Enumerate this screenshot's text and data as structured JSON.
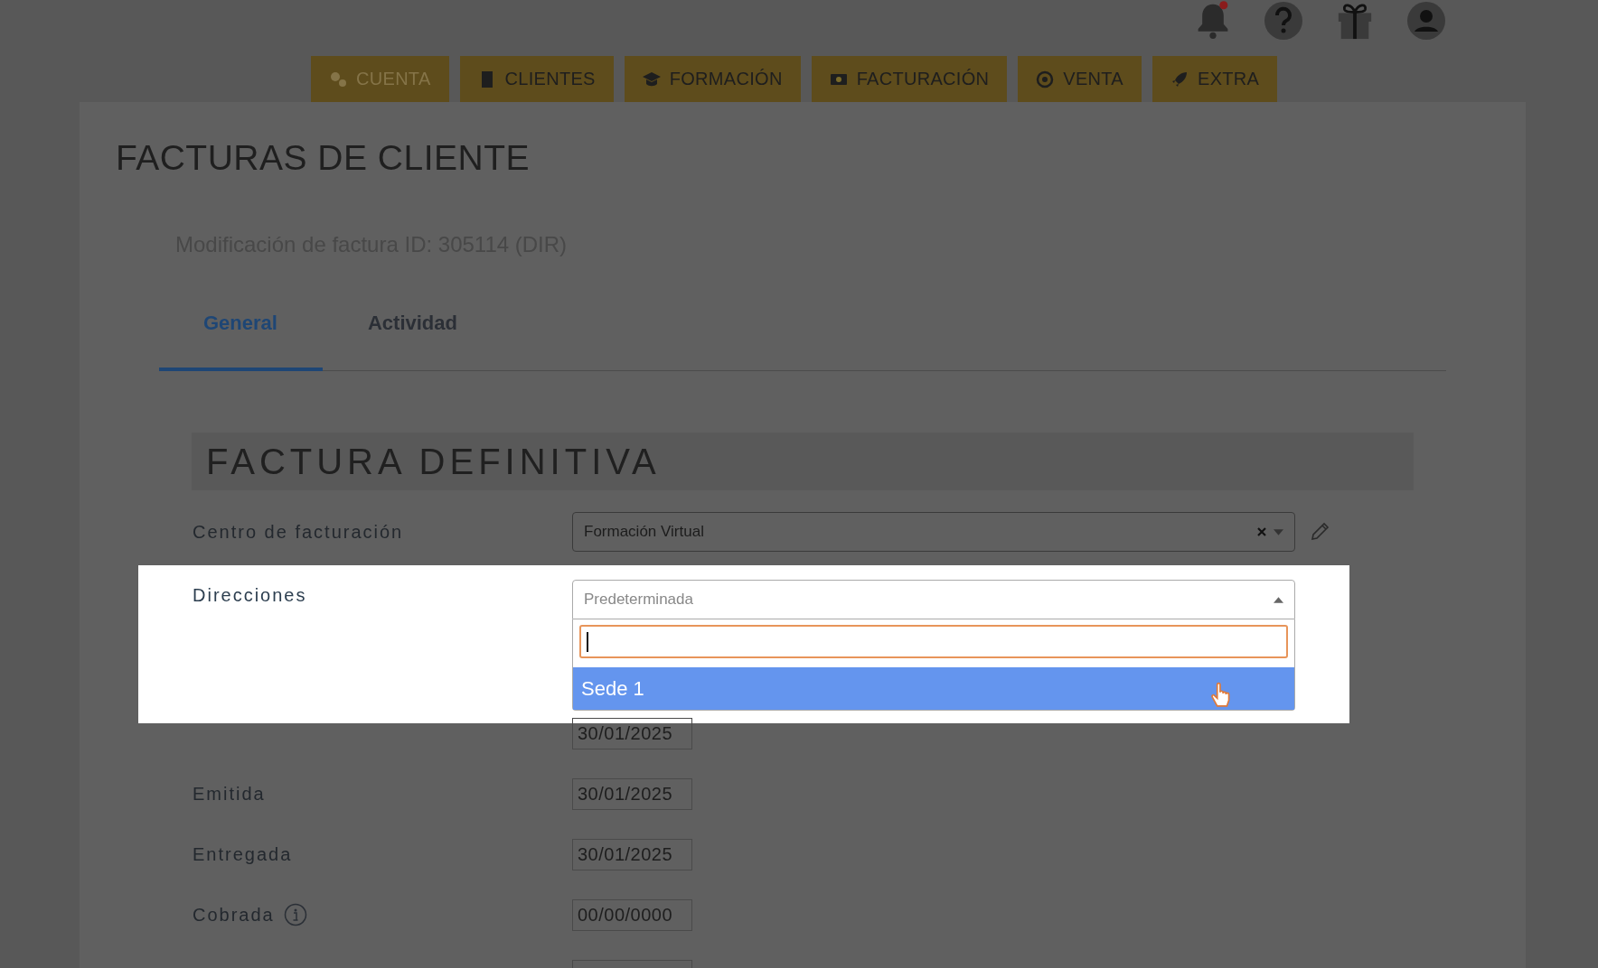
{
  "header_icons": {
    "notification_dot": true
  },
  "nav": [
    {
      "label": "CUENTA",
      "disabled": true
    },
    {
      "label": "CLIENTES",
      "disabled": false
    },
    {
      "label": "FORMACIÓN",
      "disabled": false
    },
    {
      "label": "FACTURACIÓN",
      "disabled": false
    },
    {
      "label": "VENTA",
      "disabled": false
    },
    {
      "label": "EXTRA",
      "disabled": false
    }
  ],
  "page_title": "FACTURAS DE CLIENTE",
  "subtitle": "Modificación de factura ID: 305114 (DIR)",
  "tabs": [
    {
      "label": "General",
      "selected": true
    },
    {
      "label": "Actividad",
      "selected": false
    }
  ],
  "section_title": "FACTURA DEFINITIVA",
  "billing_center": {
    "label": "Centro de facturación",
    "value": "Formación Virtual"
  },
  "addresses": {
    "label": "Direcciones",
    "placeholder": "Predeterminada",
    "expanded": true,
    "options": [
      {
        "label": "Sede 1",
        "selected": true
      }
    ]
  },
  "date_rows": [
    {
      "label": "",
      "value": "30/01/2025",
      "info": false
    },
    {
      "label": "Emitida",
      "value": "30/01/2025",
      "info": false
    },
    {
      "label": "Entregada",
      "value": "30/01/2025",
      "info": false
    },
    {
      "label": "Cobrada",
      "value": "00/00/0000",
      "info": true
    },
    {
      "label": "",
      "value": "",
      "info": false
    }
  ]
}
